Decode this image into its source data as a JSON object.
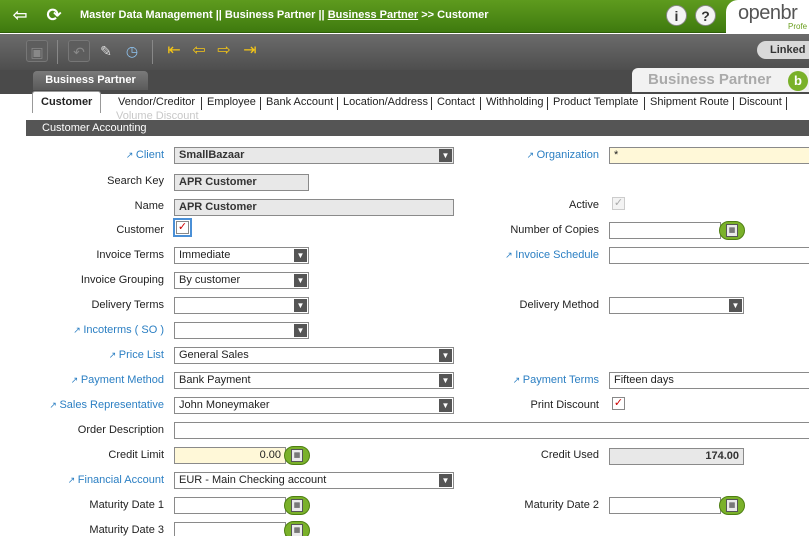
{
  "header": {
    "breadcrumb_prefix": "Master Data Management || Business Partner ||",
    "breadcrumb_link": "Business Partner",
    "breadcrumb_sep": ">>",
    "breadcrumb_current": "Customer",
    "logo_text": "openbr",
    "logo_sub": "Profe"
  },
  "toolbar": {
    "linked_label": "Linked"
  },
  "window": {
    "tab_label": "Business Partner",
    "title": "Business Partner"
  },
  "tabs": [
    "Customer",
    "Vendor/Creditor",
    "Employee",
    "Bank Account",
    "Location/Address",
    "Contact",
    "Withholding",
    "Product Template",
    "Shipment Route",
    "Discount"
  ],
  "tabs_wrapped": "Volume Discount",
  "subtab": "Customer Accounting",
  "form": {
    "client": {
      "label": "Client",
      "value": "SmallBazaar"
    },
    "organization": {
      "label": "Organization",
      "value": "*"
    },
    "search_key": {
      "label": "Search Key",
      "value": "APR Customer"
    },
    "name": {
      "label": "Name",
      "value": "APR Customer"
    },
    "active": {
      "label": "Active",
      "checked": true
    },
    "customer": {
      "label": "Customer",
      "checked": true
    },
    "number_of_copies": {
      "label": "Number of Copies",
      "value": ""
    },
    "invoice_terms": {
      "label": "Invoice Terms",
      "value": "Immediate"
    },
    "invoice_schedule": {
      "label": "Invoice Schedule",
      "value": ""
    },
    "invoice_grouping": {
      "label": "Invoice Grouping",
      "value": "By customer"
    },
    "delivery_terms": {
      "label": "Delivery Terms",
      "value": ""
    },
    "delivery_method": {
      "label": "Delivery Method",
      "value": ""
    },
    "incoterms": {
      "label": "Incoterms ( SO )",
      "value": ""
    },
    "price_list": {
      "label": "Price List",
      "value": "General Sales"
    },
    "payment_method": {
      "label": "Payment Method",
      "value": "Bank Payment"
    },
    "payment_terms": {
      "label": "Payment Terms",
      "value": "Fifteen days"
    },
    "sales_rep": {
      "label": "Sales Representative",
      "value": "John Moneymaker"
    },
    "print_discount": {
      "label": "Print Discount",
      "checked": true
    },
    "order_description": {
      "label": "Order Description",
      "value": ""
    },
    "credit_limit": {
      "label": "Credit Limit",
      "value": "0.00"
    },
    "credit_used": {
      "label": "Credit Used",
      "value": "174.00"
    },
    "financial_account": {
      "label": "Financial Account",
      "value": "EUR - Main Checking account"
    },
    "maturity_1": {
      "label": "Maturity Date 1",
      "value": ""
    },
    "maturity_2": {
      "label": "Maturity Date 2",
      "value": ""
    },
    "maturity_3": {
      "label": "Maturity Date 3",
      "value": ""
    }
  },
  "icons": [
    "back-icon",
    "refresh-icon",
    "info-icon",
    "help-icon",
    "save-icon",
    "undo-icon",
    "attach-icon",
    "audit-icon",
    "first-record-icon",
    "previous-record-icon",
    "next-record-icon",
    "last-record-icon",
    "calculator-icon",
    "dropdown-arrow-icon"
  ],
  "colors": {
    "header_green": "#4a8a16",
    "link_blue": "#2b7fc3",
    "required_yellow": "#fff8d8",
    "toolbar_gray": "#5a5a5a"
  }
}
